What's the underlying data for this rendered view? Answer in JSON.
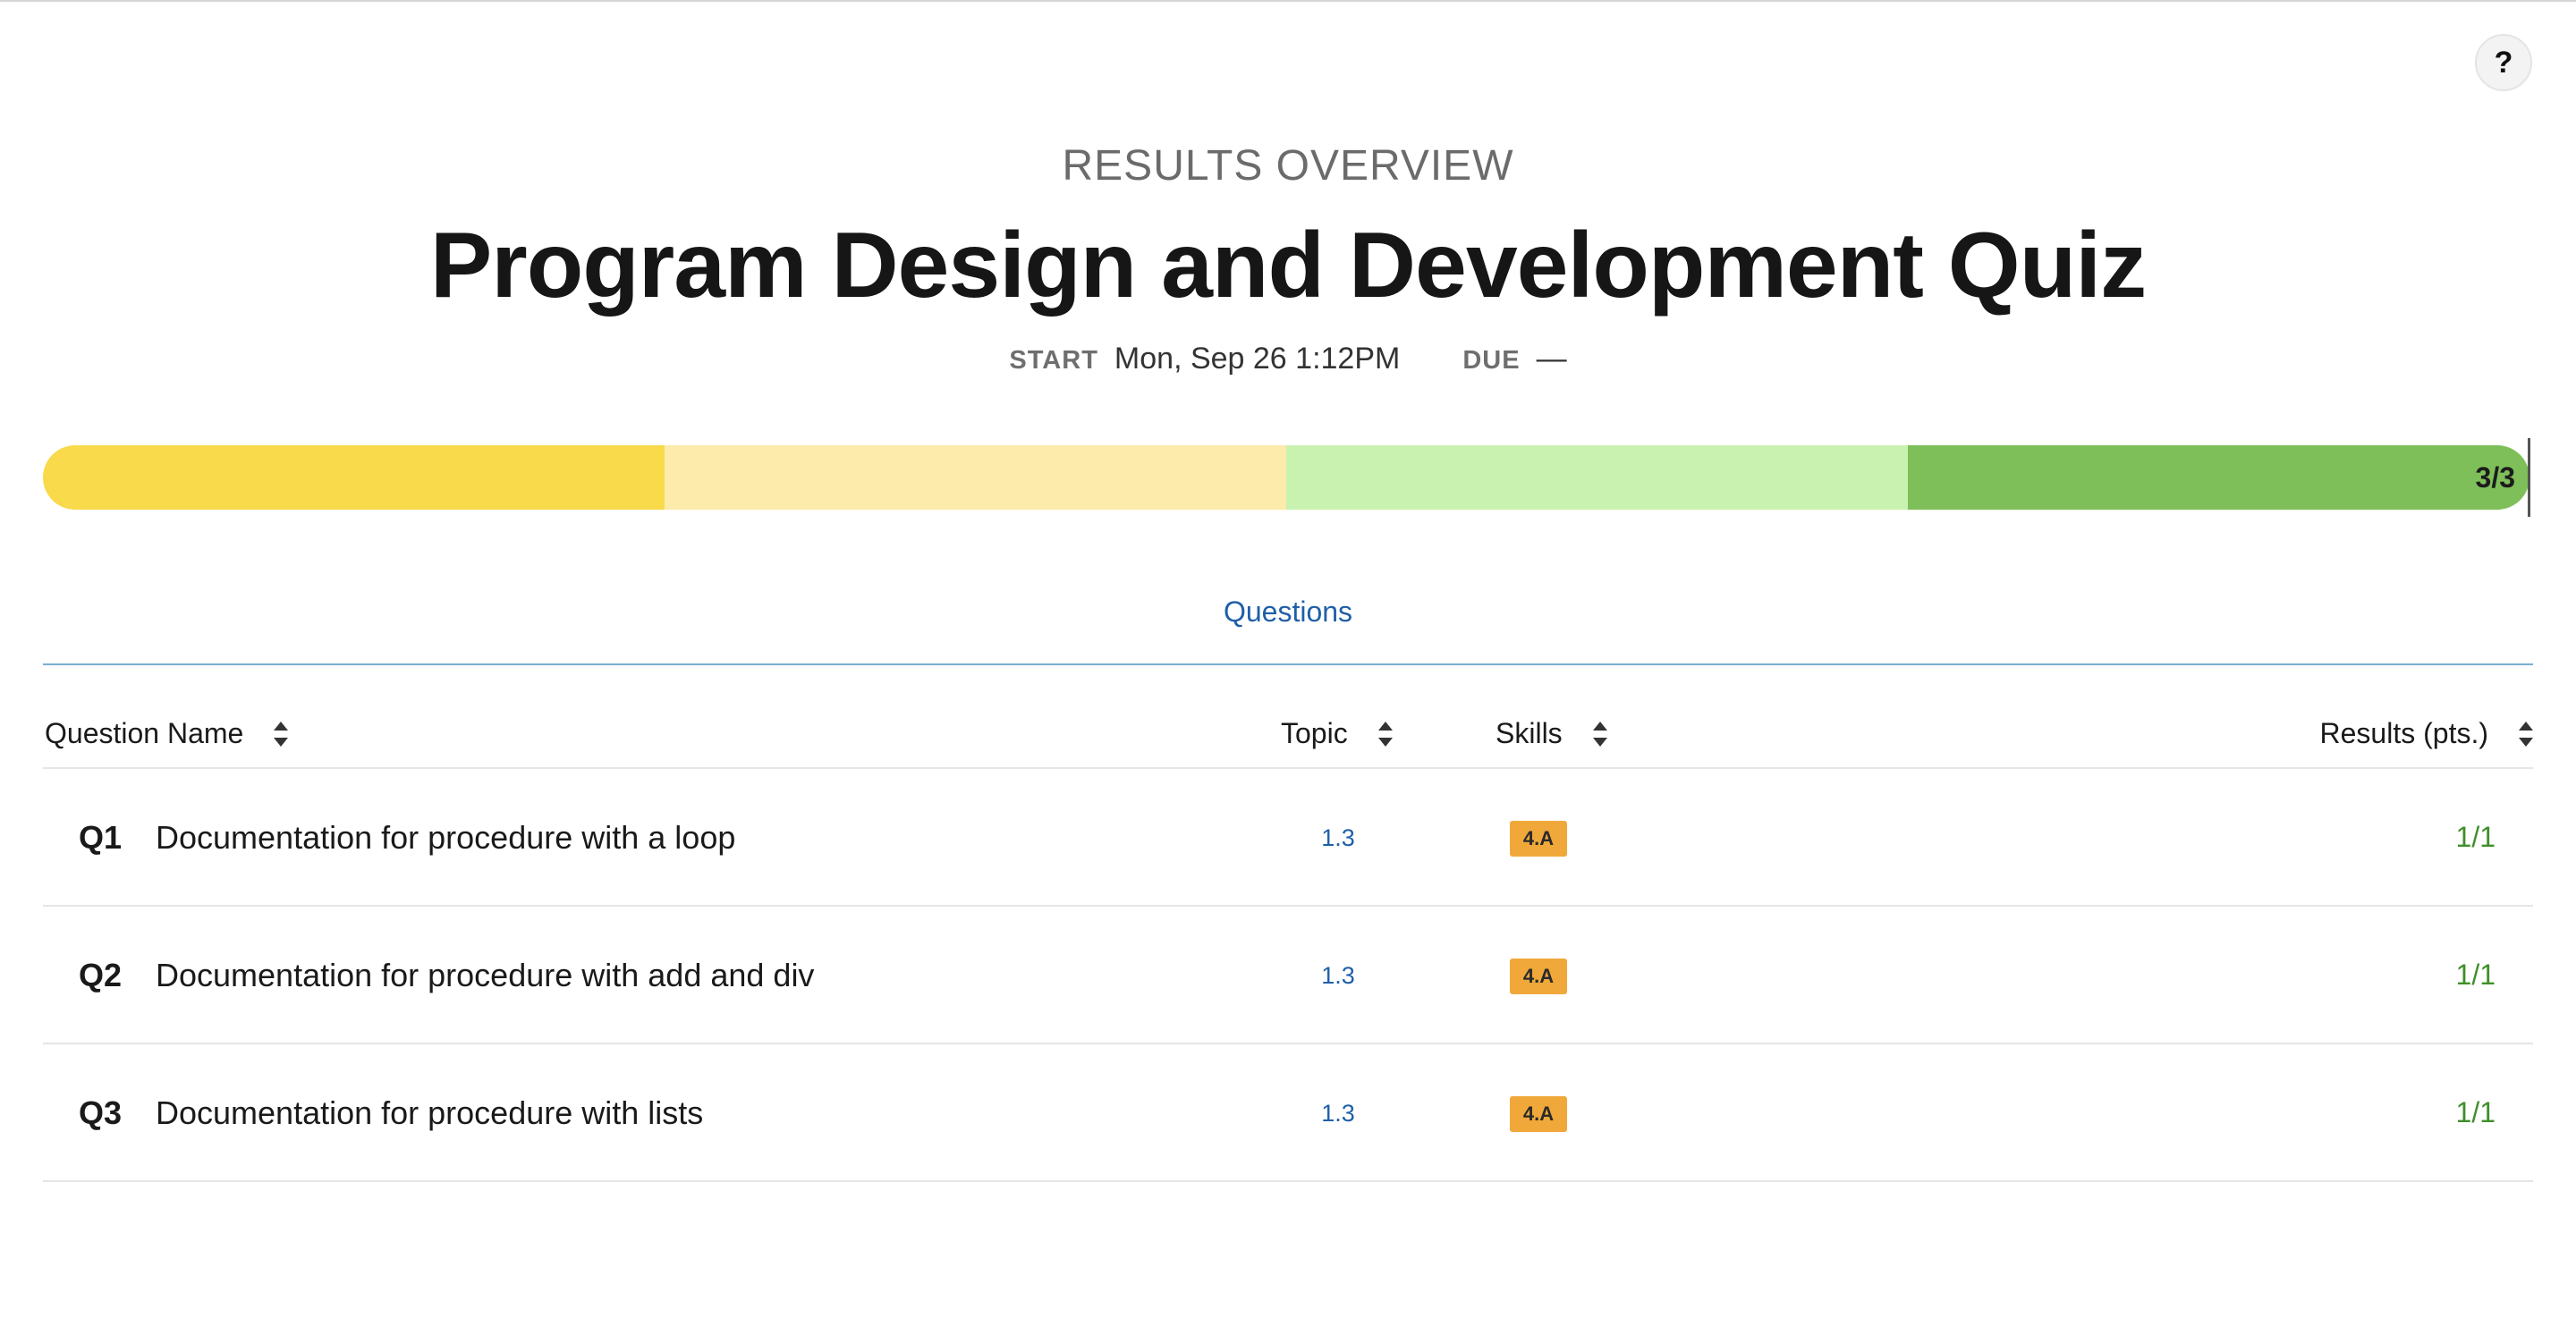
{
  "header": {
    "help_label": "?",
    "overline": "RESULTS OVERVIEW",
    "title": "Program Design and Development Quiz",
    "start_label": "START",
    "start_value": "Mon, Sep 26 1:12PM",
    "due_label": "DUE",
    "due_value": "—"
  },
  "progress": {
    "label": "3/3",
    "score": 3,
    "max": 3,
    "segment_colors": [
      "#f8da4a",
      "#fcebaa",
      "#c9f2b1",
      "#7fbf5a"
    ]
  },
  "tabs": [
    {
      "label": "Questions",
      "active": true
    }
  ],
  "table": {
    "columns": {
      "name": "Question Name",
      "topic": "Topic",
      "skills": "Skills",
      "results": "Results (pts.)"
    },
    "rows": [
      {
        "num": "Q1",
        "name": "Documentation for procedure with a loop",
        "topic": "1.3",
        "skill": "4.A",
        "result": "1/1"
      },
      {
        "num": "Q2",
        "name": "Documentation for procedure with add and div",
        "topic": "1.3",
        "skill": "4.A",
        "result": "1/1"
      },
      {
        "num": "Q3",
        "name": "Documentation for procedure with lists",
        "topic": "1.3",
        "skill": "4.A",
        "result": "1/1"
      }
    ]
  },
  "colors": {
    "accent_blue": "#1f5fa8",
    "result_green": "#3f8f2a",
    "skill_badge": "#f0a83a"
  }
}
